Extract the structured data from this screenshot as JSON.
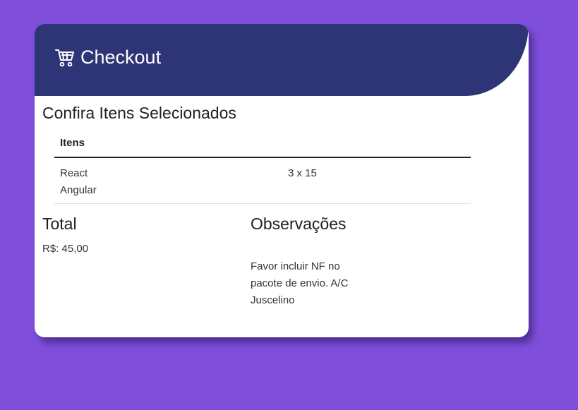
{
  "header": {
    "title": "Checkout",
    "icon": "shopping-cart-icon"
  },
  "items_section": {
    "title": "Confira Itens Selecionados",
    "column_header": "Itens",
    "items": [
      "React",
      "Angular"
    ],
    "quantity_text": "3 x 15"
  },
  "total": {
    "label": "Total",
    "value": "R$: 45,00"
  },
  "observations": {
    "label": "Observações",
    "text": "Favor incluir NF no pacote de envio. A/C Juscelino"
  },
  "colors": {
    "background": "#7f4fdc",
    "header": "#2d3577",
    "card": "#ffffff"
  }
}
